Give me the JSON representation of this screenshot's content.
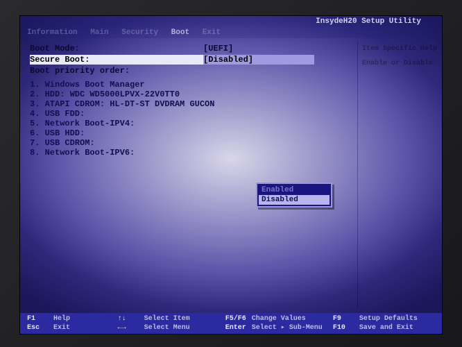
{
  "title": "InsydeH20 Setup Utility",
  "tabs": [
    "Information",
    "Main",
    "Security",
    "Boot",
    "Exit"
  ],
  "active_tab": "Boot",
  "settings": {
    "boot_mode": {
      "label": "Boot Mode:",
      "value": "[UEFI]"
    },
    "secure_boot": {
      "label": "Secure Boot:",
      "value": "[Disabled]"
    },
    "boot_priority_label": "Boot priority order:"
  },
  "boot_order": [
    "1. Windows Boot Manager",
    "2. HDD: WDC WD5000LPVX-22V0TT0",
    "3. ATAPI CDROM: HL-DT-ST DVDRAM GUCON",
    "4. USB FDD:",
    "5. Network Boot-IPV4:",
    "6. USB HDD:",
    "7. USB CDROM:",
    "8. Network Boot-IPV6:"
  ],
  "popup": {
    "option_enabled": "Enabled",
    "option_disabled": "Disabled",
    "selected": "Disabled"
  },
  "right_panel": {
    "header": "Item Specific Help",
    "text": "Enable or Disable"
  },
  "footer": {
    "f1": {
      "key": "F1",
      "label": "Help"
    },
    "esc": {
      "key": "Esc",
      "label": "Exit"
    },
    "updown": {
      "key": "↑↓",
      "label": "Select Item"
    },
    "enter": {
      "key": "Enter",
      "label": "Select ▸ Sub-Menu"
    },
    "f5f6": {
      "key": "F5/F6",
      "label": "Change Values"
    },
    "f9": {
      "key": "F9",
      "label": "Setup Defaults"
    },
    "leftright": {
      "key": "←→",
      "label": "Select Menu"
    },
    "f10": {
      "key": "F10",
      "label": "Save and Exit"
    }
  }
}
